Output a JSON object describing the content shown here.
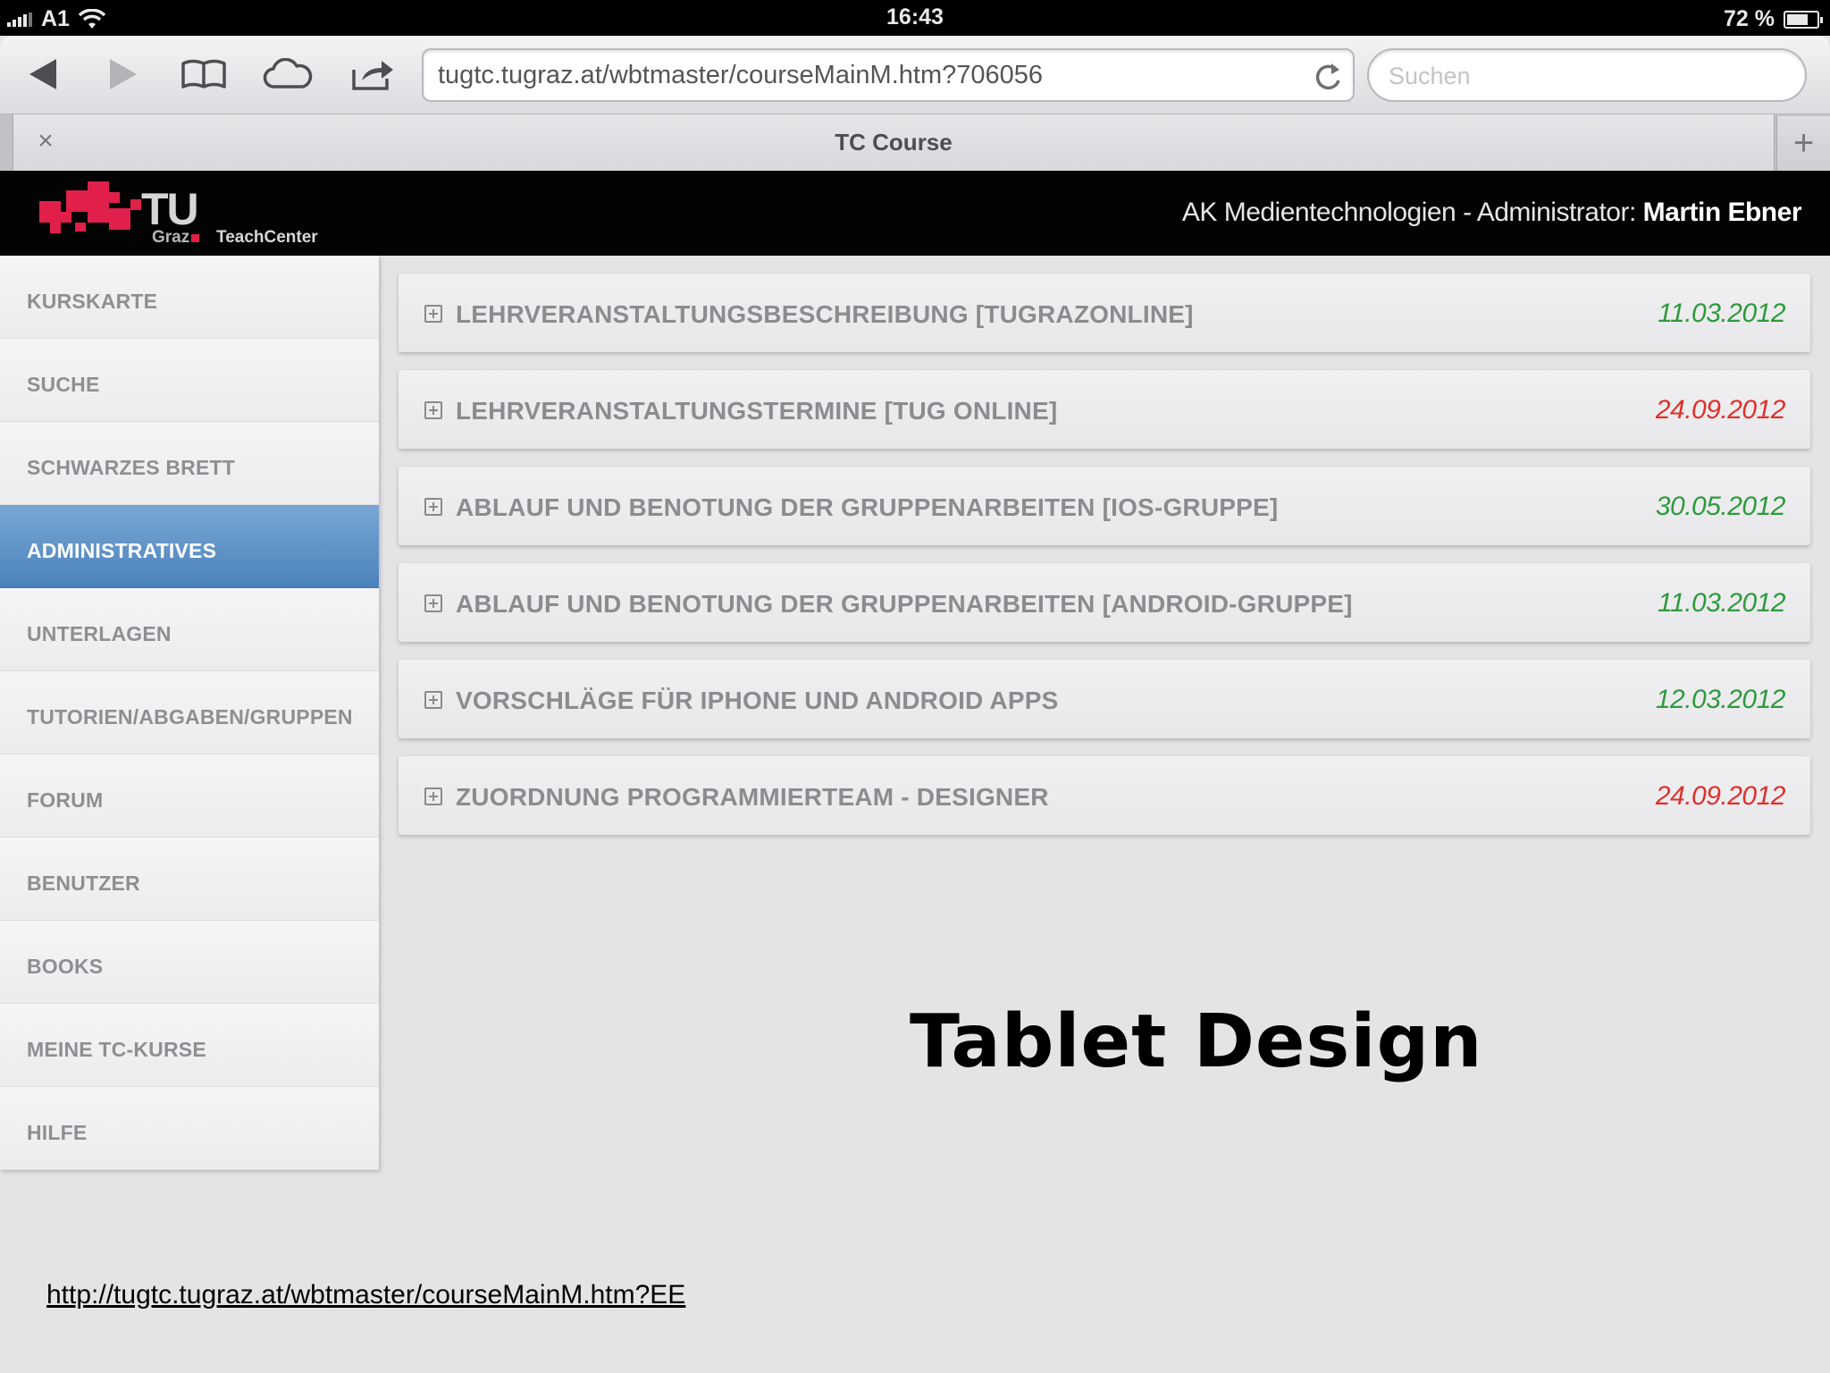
{
  "status_bar": {
    "carrier": "A1",
    "time": "16:43",
    "battery_text": "72 %",
    "battery_level": 0.72
  },
  "browser": {
    "url": "tugtc.tugraz.at/wbtmaster/courseMainM.htm?706056",
    "search_placeholder": "Suchen",
    "tab_title": "TC Course",
    "tab_close": "×",
    "new_tab": "+"
  },
  "header": {
    "logo": {
      "tu": "TU",
      "graz": "Graz",
      "teachcenter": "TeachCenter"
    },
    "org": "AK Medientechnologien - Administrator: ",
    "user": "Martin Ebner"
  },
  "sidebar": {
    "items": [
      {
        "label": "KURSKARTE"
      },
      {
        "label": "SUCHE"
      },
      {
        "label": "SCHWARZES BRETT"
      },
      {
        "label": "ADMINISTRATIVES"
      },
      {
        "label": "UNTERLAGEN"
      },
      {
        "label": "TUTORIEN/ABGABEN/GRUPPEN"
      },
      {
        "label": "FORUM"
      },
      {
        "label": "BENUTZER"
      },
      {
        "label": "BOOKS"
      },
      {
        "label": "MEINE TC-KURSE"
      },
      {
        "label": "HILFE"
      }
    ],
    "active_index": 3
  },
  "content": {
    "rows": [
      {
        "label": "LEHRVERANSTALTUNGSBESCHREIBUNG [TUGRAZONLINE]",
        "date": "11.03.2012",
        "date_color": "#2e9a3c"
      },
      {
        "label": "LEHRVERANSTALTUNGSTERMINE [TUG ONLINE]",
        "date": "24.09.2012",
        "date_color": "#e0302a"
      },
      {
        "label": "ABLAUF UND BENOTUNG DER GRUPPENARBEITEN [IOS-GRUPPE]",
        "date": "30.05.2012",
        "date_color": "#2e9a3c"
      },
      {
        "label": "ABLAUF UND BENOTUNG DER GRUPPENARBEITEN [ANDROID-GRUPPE]",
        "date": "11.03.2012",
        "date_color": "#2e9a3c"
      },
      {
        "label": "VORSCHLÄGE FÜR IPHONE UND ANDROID APPS",
        "date": "12.03.2012",
        "date_color": "#2e9a3c"
      },
      {
        "label": "ZUORDNUNG PROGRAMMIERTEAM - DESIGNER",
        "date": "24.09.2012",
        "date_color": "#e0302a"
      }
    ]
  },
  "overlay": {
    "caption": "Tablet Design",
    "link": "http://tugtc.tugraz.at/wbtmaster/courseMainM.htm?EE"
  },
  "colors": {
    "accent_blue": "#5b8fc6",
    "date_green": "#2e9a3c",
    "date_red": "#e0302a",
    "brand_red": "#e0204a"
  },
  "icons": {
    "back": "back-arrow-icon",
    "forward": "forward-arrow-icon",
    "bookmarks": "bookmarks-book-icon",
    "cloud": "cloud-icon",
    "share": "share-icon",
    "reload": "reload-icon",
    "expand": "plus-box-icon",
    "wifi": "wifi-icon",
    "signal": "signal-bars-icon",
    "battery": "battery-icon"
  }
}
